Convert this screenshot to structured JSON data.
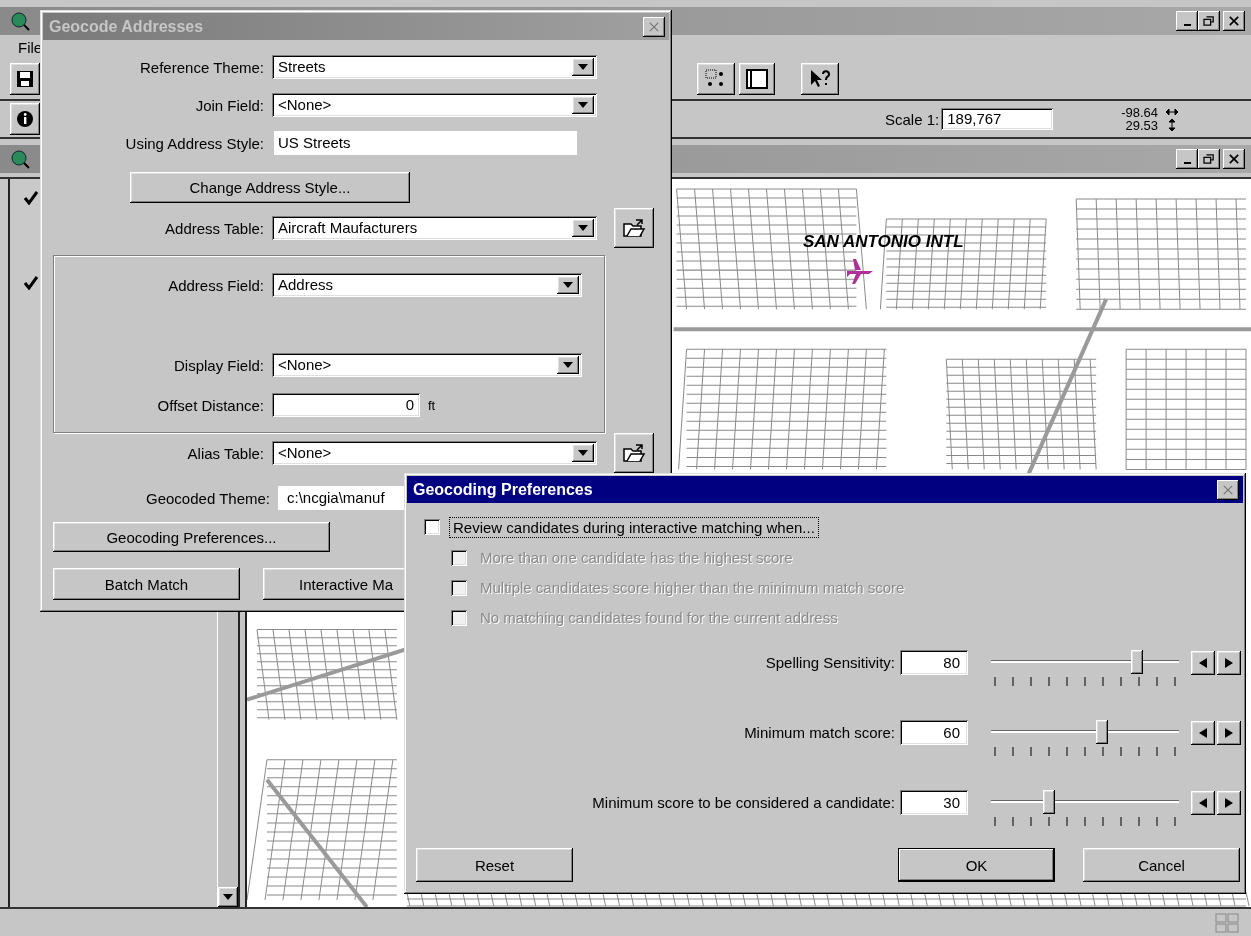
{
  "app": {
    "menu": [
      "File"
    ],
    "scale_label": "Scale 1:",
    "scale": "189,767",
    "x_coord": "-98.64",
    "y_coord": "29.53"
  },
  "view": {
    "themes": [
      {
        "checked": true
      },
      {
        "checked": true
      }
    ],
    "map_label": "SAN ANTONIO INTL"
  },
  "geocode_dialog": {
    "title": "Geocode Addresses",
    "active": false,
    "reference_theme": {
      "label": "Reference Theme:",
      "value": "Streets"
    },
    "join_field": {
      "label": "Join Field:",
      "value": "<None>"
    },
    "address_style": {
      "label": "Using Address Style:",
      "value": "US Streets"
    },
    "change_style_button": "Change Address Style...",
    "address_table": {
      "label": "Address Table:",
      "value": "Aircraft Maufacturers"
    },
    "address_field": {
      "label": "Address Field:",
      "value": "Address"
    },
    "display_field": {
      "label": "Display Field:",
      "value": "<None>"
    },
    "offset_distance": {
      "label": "Offset Distance:",
      "value": "0",
      "unit": "ft"
    },
    "alias_table": {
      "label": "Alias Table:",
      "value": "<None>"
    },
    "geocoded_theme": {
      "label": "Geocoded Theme:",
      "value": "c:\\ncgia\\manuf"
    },
    "preferences_button": "Geocoding Preferences...",
    "batch_button": "Batch Match",
    "interactive_button": "Interactive Ma"
  },
  "preferences_dialog": {
    "title": "Geocoding Preferences",
    "active": true,
    "review": {
      "label": "Review candidates during interactive matching when...",
      "checked": false,
      "focused": true
    },
    "conditions": [
      {
        "label": "More than one candidate has the highest score",
        "checked": false,
        "disabled": true
      },
      {
        "label": "Multiple candidates score higher than the minimum match score",
        "checked": false,
        "disabled": true
      },
      {
        "label": "No matching candidates found for the current address",
        "checked": false,
        "disabled": true
      }
    ],
    "sliders": [
      {
        "label": "Spelling Sensitivity:",
        "value": "80",
        "level": 0.8
      },
      {
        "label": "Minimum match score:",
        "value": "60",
        "level": 0.6
      },
      {
        "label": "Minimum score to be considered a candidate:",
        "value": "30",
        "level": 0.3
      }
    ],
    "buttons": [
      {
        "label": "Reset",
        "default": false
      },
      {
        "label": "OK",
        "default": true
      },
      {
        "label": "Cancel",
        "default": false
      }
    ]
  }
}
